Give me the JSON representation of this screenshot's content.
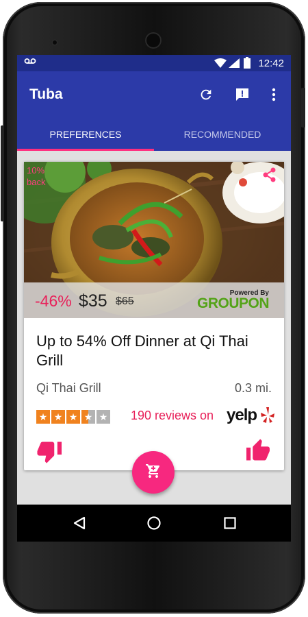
{
  "status_bar": {
    "time": "12:42",
    "voicemail_icon": "voicemail-icon",
    "wifi_icon": "wifi-icon",
    "signal_icon": "signal-icon",
    "battery_icon": "battery-icon"
  },
  "app_bar": {
    "title": "Tuba",
    "refresh_icon": "refresh-icon",
    "feedback_icon": "feedback-icon",
    "more_icon": "more-vert-icon"
  },
  "tabs": [
    {
      "label": "PREFERENCES",
      "selected": true
    },
    {
      "label": "RECOMMENDED",
      "selected": false
    }
  ],
  "deal": {
    "cashback_line1": "10%",
    "cashback_line2": "back",
    "discount": "-46%",
    "price": "$35",
    "old_price": "$65",
    "powered_by": "Powered By",
    "provider": "GROUPON",
    "title": "Up to 54% Off Dinner at Qi Thai Grill",
    "merchant": "Qi Thai Grill",
    "distance": "0.3 mi.",
    "rating": 3.5,
    "rating_max": 5,
    "reviews_text": "190 reviews on",
    "review_source": "yelp"
  },
  "colors": {
    "primary": "#2c3aa8",
    "primary_dark": "#1f2d8a",
    "accent": "#f7287f",
    "tab_indicator": "#ff2e7e",
    "discount": "#e8215a",
    "star_filled": "#f0821e",
    "star_empty": "#b3b3b3",
    "groupon": "#53a318"
  },
  "nav": {
    "back_icon": "back-triangle-icon",
    "home_icon": "home-circle-icon",
    "recents_icon": "recents-square-icon"
  }
}
